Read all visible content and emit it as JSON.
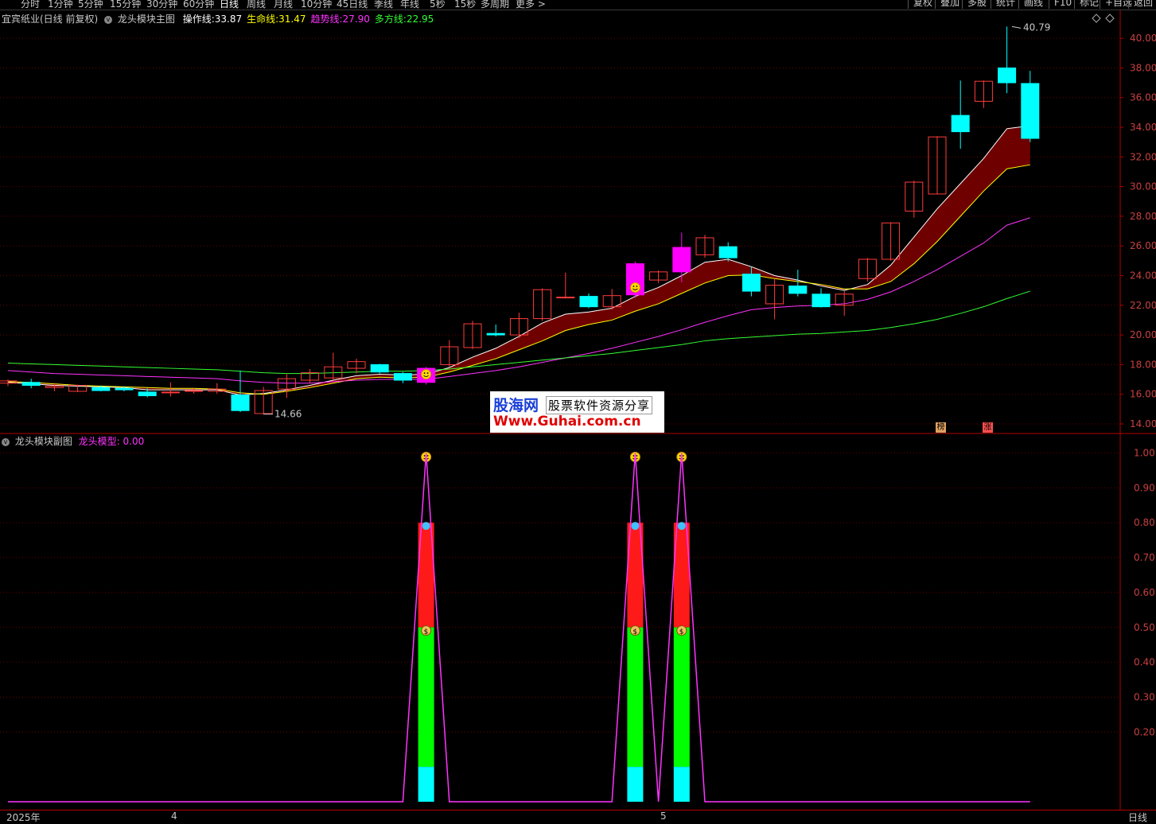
{
  "toolbar": {
    "tabs": [
      "分时",
      "1分钟",
      "5分钟",
      "15分钟",
      "30分钟",
      "60分钟",
      "日线",
      "周线",
      "月线",
      "10分钟",
      "45日线",
      "季线",
      "年线",
      "5秒",
      "15秒",
      "多周期",
      "更多 >"
    ],
    "active_tab": "日线",
    "right_buttons": [
      "复权",
      "叠加",
      "多股",
      "统计",
      "画线",
      "F10",
      "标记",
      "+自选",
      "返回"
    ]
  },
  "main": {
    "stock_title": "宜宾纸业(日线 前复权)",
    "indicator_name": "龙头模块主图",
    "lines": [
      {
        "label": "操作线:",
        "value": "33.87",
        "color": "#ffffff"
      },
      {
        "label": "生命线:",
        "value": "31.47",
        "color": "#ffff00"
      },
      {
        "label": "趋势线:",
        "value": "27.90",
        "color": "#ff33ff"
      },
      {
        "label": "多方线:",
        "value": "22.95",
        "color": "#33ff33"
      }
    ],
    "high_label": "40.79",
    "low_label": "14.66",
    "badge_a": "榜",
    "badge_b": "涨"
  },
  "sub": {
    "indicator_name": "龙头模块副图",
    "value_label": "龙头模型:",
    "value": "0.00"
  },
  "watermark": {
    "brand": "股海网",
    "slogan": "股票软件资源分享",
    "url": "Www.Guhai.com.cn"
  },
  "bottom": {
    "dates": [
      "2025年",
      "4",
      "5"
    ],
    "period": "日线"
  },
  "chart_data": {
    "type": "candlestick",
    "price_axis": {
      "min": 14,
      "max": 40,
      "ticks": [
        14,
        16,
        18,
        20,
        22,
        24,
        26,
        28,
        30,
        32,
        34,
        36,
        38,
        40
      ]
    },
    "sub_axis": {
      "min": 0,
      "max": 1,
      "ticks": [
        0.2,
        0.3,
        0.4,
        0.5,
        0.6,
        0.7,
        0.8,
        0.9,
        1.0
      ]
    },
    "candles": [
      {
        "o": 16.75,
        "h": 17.0,
        "l": 16.55,
        "c": 16.9
      },
      {
        "o": 16.8,
        "h": 17.05,
        "l": 16.4,
        "c": 16.6
      },
      {
        "o": 16.45,
        "h": 16.75,
        "l": 16.2,
        "c": 16.55
      },
      {
        "o": 16.2,
        "h": 16.65,
        "l": 16.15,
        "c": 16.6
      },
      {
        "o": 16.45,
        "h": 16.6,
        "l": 16.2,
        "c": 16.25
      },
      {
        "o": 16.4,
        "h": 16.55,
        "l": 16.2,
        "c": 16.3
      },
      {
        "o": 16.15,
        "h": 16.4,
        "l": 15.8,
        "c": 15.9
      },
      {
        "o": 16.1,
        "h": 16.8,
        "l": 15.85,
        "c": 16.15
      },
      {
        "o": 16.2,
        "h": 16.4,
        "l": 16.05,
        "c": 16.25
      },
      {
        "o": 16.2,
        "h": 16.75,
        "l": 16.05,
        "c": 16.35
      },
      {
        "o": 15.95,
        "h": 17.6,
        "l": 14.8,
        "c": 14.9
      },
      {
        "o": 14.7,
        "h": 16.5,
        "l": 14.66,
        "c": 16.25
      },
      {
        "o": 16.35,
        "h": 17.35,
        "l": 15.75,
        "c": 17.05
      },
      {
        "o": 16.95,
        "h": 17.7,
        "l": 16.75,
        "c": 17.45
      },
      {
        "o": 17.1,
        "h": 18.8,
        "l": 16.95,
        "c": 17.85
      },
      {
        "o": 17.75,
        "h": 18.4,
        "l": 17.4,
        "c": 18.2
      },
      {
        "o": 18.0,
        "h": 18.05,
        "l": 17.4,
        "c": 17.5
      },
      {
        "o": 17.4,
        "h": 17.5,
        "l": 16.75,
        "c": 16.95
      },
      {
        "o": 16.8,
        "h": 17.85,
        "l": 16.65,
        "c": 17.75
      },
      {
        "o": 18.0,
        "h": 19.65,
        "l": 17.85,
        "c": 19.2
      },
      {
        "o": 19.15,
        "h": 20.95,
        "l": 19.05,
        "c": 20.75
      },
      {
        "o": 20.1,
        "h": 20.7,
        "l": 19.9,
        "c": 20.0
      },
      {
        "o": 20.0,
        "h": 21.5,
        "l": 19.8,
        "c": 21.1
      },
      {
        "o": 21.1,
        "h": 23.15,
        "l": 20.95,
        "c": 23.05
      },
      {
        "o": 22.5,
        "h": 24.2,
        "l": 22.45,
        "c": 22.55
      },
      {
        "o": 22.6,
        "h": 22.8,
        "l": 21.8,
        "c": 21.9
      },
      {
        "o": 21.9,
        "h": 23.1,
        "l": 21.7,
        "c": 22.65
      },
      {
        "o": 22.7,
        "h": 24.95,
        "l": 22.5,
        "c": 24.8
      },
      {
        "o": 23.7,
        "h": 24.35,
        "l": 23.5,
        "c": 24.25
      },
      {
        "o": 24.25,
        "h": 26.9,
        "l": 23.55,
        "c": 25.9
      },
      {
        "o": 25.4,
        "h": 26.75,
        "l": 25.2,
        "c": 26.55
      },
      {
        "o": 25.95,
        "h": 26.25,
        "l": 24.95,
        "c": 25.2
      },
      {
        "o": 24.1,
        "h": 24.6,
        "l": 22.6,
        "c": 22.95
      },
      {
        "o": 22.1,
        "h": 23.8,
        "l": 21.05,
        "c": 23.35
      },
      {
        "o": 23.3,
        "h": 24.4,
        "l": 22.6,
        "c": 22.8
      },
      {
        "o": 22.75,
        "h": 23.15,
        "l": 21.85,
        "c": 21.9
      },
      {
        "o": 22.0,
        "h": 22.95,
        "l": 21.3,
        "c": 22.75
      },
      {
        "o": 23.8,
        "h": 25.2,
        "l": 23.6,
        "c": 25.1
      },
      {
        "o": 25.1,
        "h": 27.6,
        "l": 25.0,
        "c": 27.55
      },
      {
        "o": 28.35,
        "h": 30.4,
        "l": 27.9,
        "c": 30.3
      },
      {
        "o": 29.5,
        "h": 33.4,
        "l": 29.5,
        "c": 33.35
      },
      {
        "o": 34.8,
        "h": 37.15,
        "l": 32.55,
        "c": 33.7
      },
      {
        "o": 35.75,
        "h": 37.15,
        "l": 35.3,
        "c": 37.1
      },
      {
        "o": 38.0,
        "h": 40.79,
        "l": 36.3,
        "c": 37.0
      },
      {
        "o": 36.95,
        "h": 37.8,
        "l": 33.0,
        "c": 33.25
      }
    ],
    "candle_colors": {
      "44": "#00ffff",
      "10": "#00ffff"
    },
    "magenta_candles": [
      18,
      27,
      29
    ],
    "series": [
      {
        "name": "操作线",
        "color": "#ffffff",
        "values": [
          16.8,
          16.7,
          16.6,
          16.55,
          16.5,
          16.45,
          16.3,
          16.3,
          16.3,
          16.3,
          15.95,
          16.05,
          16.3,
          16.6,
          16.95,
          17.25,
          17.35,
          17.3,
          17.35,
          17.8,
          18.5,
          19.1,
          19.9,
          20.8,
          21.4,
          21.55,
          21.8,
          22.6,
          23.2,
          24.0,
          24.9,
          25.1,
          24.6,
          24.0,
          23.7,
          23.3,
          23.0,
          23.4,
          24.7,
          26.6,
          28.5,
          30.2,
          31.9,
          33.9,
          34.1
        ]
      },
      {
        "name": "生命线",
        "color": "#ffff00",
        "values": [
          16.85,
          16.8,
          16.7,
          16.6,
          16.55,
          16.5,
          16.45,
          16.4,
          16.4,
          16.35,
          16.1,
          16.0,
          16.2,
          16.45,
          16.75,
          17.05,
          17.15,
          17.1,
          17.15,
          17.5,
          17.95,
          18.4,
          19.0,
          19.6,
          20.3,
          20.7,
          21.0,
          21.6,
          22.1,
          22.8,
          23.5,
          24.0,
          24.05,
          23.8,
          23.6,
          23.4,
          23.1,
          23.1,
          23.6,
          24.8,
          26.3,
          28.0,
          29.7,
          31.2,
          31.47
        ]
      },
      {
        "name": "趋势线",
        "color": "#ff33ff",
        "values": [
          17.6,
          17.5,
          17.4,
          17.35,
          17.3,
          17.25,
          17.2,
          17.15,
          17.1,
          17.05,
          16.9,
          16.8,
          16.75,
          16.75,
          16.85,
          16.95,
          17.0,
          17.0,
          17.0,
          17.2,
          17.4,
          17.6,
          17.85,
          18.15,
          18.45,
          18.75,
          19.1,
          19.5,
          19.9,
          20.35,
          20.85,
          21.3,
          21.7,
          21.85,
          21.95,
          22.0,
          22.1,
          22.4,
          22.9,
          23.6,
          24.4,
          25.3,
          26.2,
          27.4,
          27.9
        ]
      },
      {
        "name": "多方线",
        "color": "#33ff33",
        "values": [
          18.1,
          18.05,
          18.0,
          17.95,
          17.9,
          17.85,
          17.8,
          17.75,
          17.7,
          17.65,
          17.55,
          17.45,
          17.4,
          17.4,
          17.45,
          17.5,
          17.55,
          17.55,
          17.6,
          17.7,
          17.85,
          18.0,
          18.15,
          18.3,
          18.45,
          18.6,
          18.75,
          18.95,
          19.15,
          19.35,
          19.6,
          19.75,
          19.85,
          19.95,
          20.05,
          20.1,
          20.2,
          20.3,
          20.5,
          20.75,
          21.05,
          21.45,
          21.9,
          22.45,
          22.95
        ]
      }
    ],
    "smiley_main": [
      18,
      27
    ],
    "sub_values": [
      0,
      0,
      0,
      0,
      0,
      0,
      0,
      0,
      0,
      0,
      0,
      0,
      0,
      0,
      0,
      0,
      0,
      0,
      1,
      0,
      0,
      0,
      0,
      0,
      0,
      0,
      0,
      1,
      0,
      1,
      0,
      0,
      0,
      0,
      0,
      0,
      0,
      0,
      0,
      0,
      0,
      0,
      0,
      0,
      0
    ]
  }
}
